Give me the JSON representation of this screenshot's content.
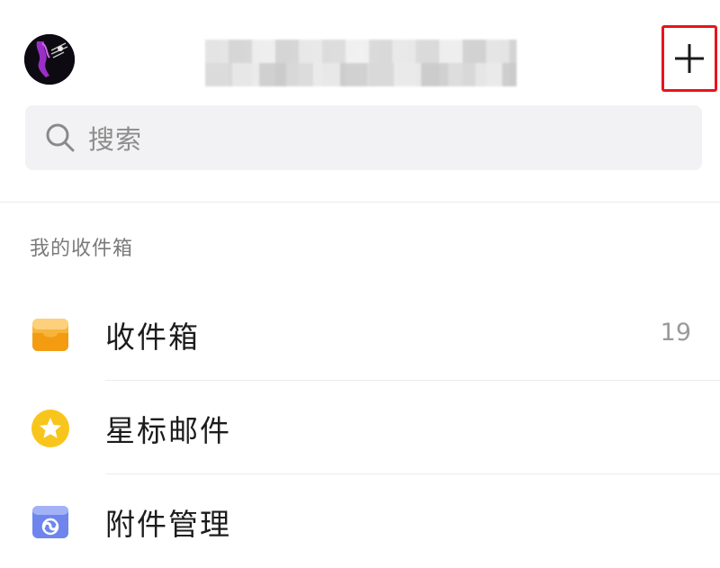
{
  "header": {
    "avatar_label": "avatar",
    "add_label": "+"
  },
  "search": {
    "placeholder": "搜索"
  },
  "section": {
    "title": "我的收件箱"
  },
  "folders": [
    {
      "label": "收件箱",
      "count": "19",
      "icon": "inbox-icon",
      "color": "#f6a51f"
    },
    {
      "label": "星标邮件",
      "count": "",
      "icon": "star-icon",
      "color": "#f8c51c"
    },
    {
      "label": "附件管理",
      "count": "",
      "icon": "attachment-icon",
      "color": "#6e85ee"
    }
  ]
}
